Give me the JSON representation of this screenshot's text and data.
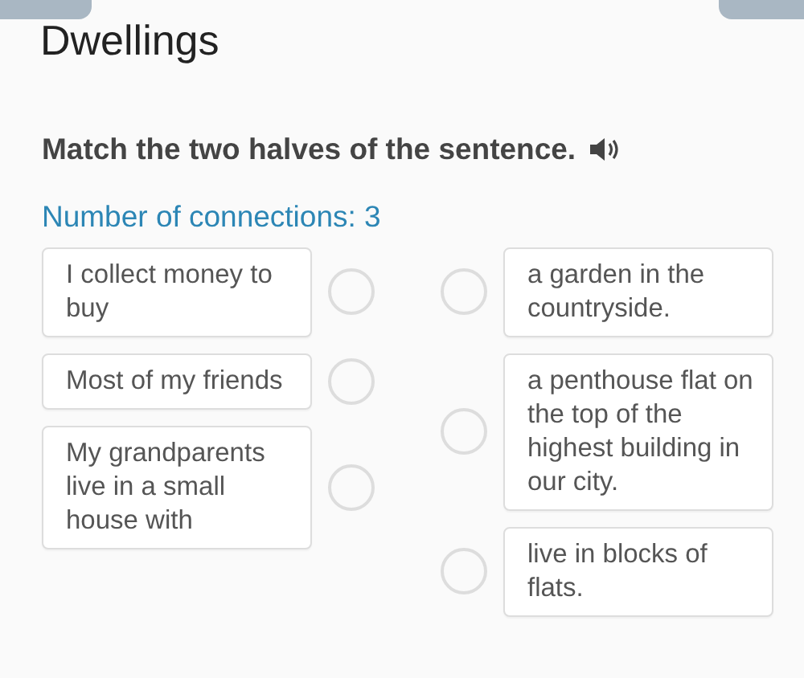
{
  "title": "Dwellings",
  "instruction": "Match the two halves of the sentence.",
  "connections": "Number of connections: 3",
  "left_items": [
    {
      "text": "I collect money to buy"
    },
    {
      "text": "Most of my friends"
    },
    {
      "text": "My grandparents live in a small house with"
    }
  ],
  "right_items": [
    {
      "text": "a garden in the countryside."
    },
    {
      "text": "a penthouse flat on the top of the highest building in our city."
    },
    {
      "text": "live in blocks of flats."
    }
  ]
}
